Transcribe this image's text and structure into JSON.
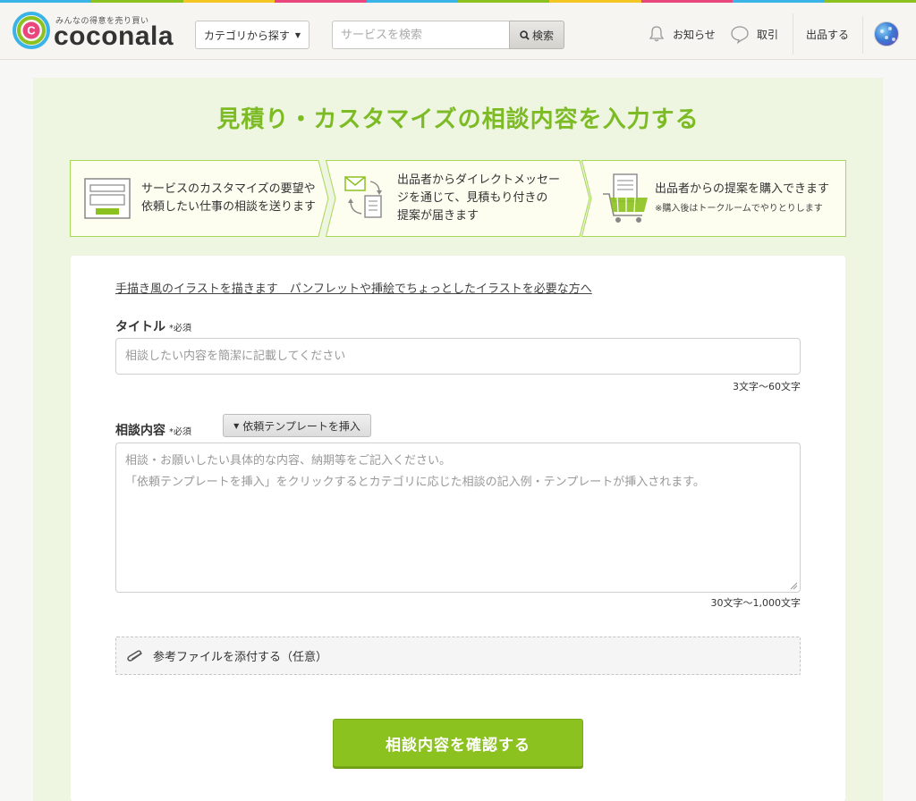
{
  "colors": {
    "accent_green": "#7dbb25",
    "button_green": "#8cc21f",
    "panel_bg": "#eef6e2",
    "step_bg": "#fdfdf0",
    "top_strip": [
      "#3ab4e6",
      "#8cc21f",
      "#f3c623",
      "#e8467c",
      "#3ab4e6",
      "#8cc21f",
      "#f3c623",
      "#e8467c",
      "#3ab4e6",
      "#8cc21f"
    ]
  },
  "header": {
    "logo_tagline": "みんなの得意を売り買い",
    "logo_word": "coconala",
    "category_button": "カテゴリから探す",
    "search": {
      "placeholder": "サービスを検索",
      "button_label": "検索"
    },
    "nav": {
      "notice": "お知らせ",
      "deal": "取引",
      "sell": "出品する"
    },
    "icons": [
      "bell-icon",
      "chat-bubble-icon",
      "search-icon",
      "avatar"
    ]
  },
  "page": {
    "title": "見積り・カスタマイズの相談内容を入力する"
  },
  "steps": [
    {
      "text_line1": "サービスのカスタマイズの要望や",
      "text_line2": "依頼したい仕事の相談を送ります",
      "icon": "form-icon"
    },
    {
      "text_line1": "出品者からダイレクトメッセー",
      "text_line2": "ジを通じて、見積もり付きの",
      "text_line3": "提案が届きます",
      "icon": "message-exchange-icon"
    },
    {
      "text_line1": "出品者からの提案を購入できます",
      "note": "※購入後はトークルームでやりとりします",
      "icon": "shopping-cart-icon"
    }
  ],
  "form": {
    "service_link": "手描き風のイラストを描きます　パンフレットや挿絵でちょっとしたイラストを必要な方へ",
    "title_field": {
      "label": "タイトル",
      "required": "*必須",
      "placeholder": "相談したい内容を簡潔に記載してください",
      "count_hint": "3文字〜60文字"
    },
    "body_field": {
      "label": "相談内容",
      "required": "*必須",
      "template_button": "依頼テンプレートを挿入",
      "placeholder_line1": "相談・お願いしたい具体的な内容、納期等をご記入ください。",
      "placeholder_line2": "「依頼テンプレートを挿入」をクリックするとカテゴリに応じた相談の記入例・テンプレートが挿入されます。",
      "count_hint": "30文字〜1,000文字"
    },
    "attach_label": "参考ファイルを添付する（任意）",
    "submit_label": "相談内容を確認する"
  }
}
